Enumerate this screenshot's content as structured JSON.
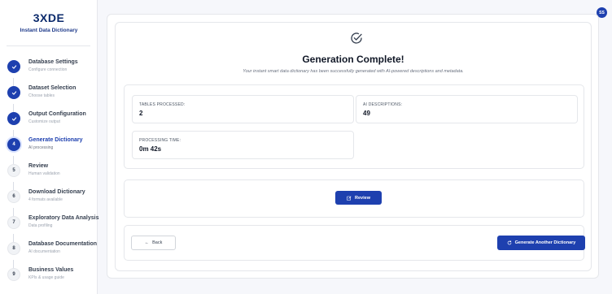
{
  "app": {
    "logo": "3XDE",
    "subtitle": "Instant Data Dictionary",
    "avatar_initials": "SS"
  },
  "steps": [
    {
      "number": "1",
      "title": "Database Settings",
      "subtitle": "Configure connection",
      "status": "completed"
    },
    {
      "number": "2",
      "title": "Dataset Selection",
      "subtitle": "Choose tables",
      "status": "completed"
    },
    {
      "number": "3",
      "title": "Output Configuration",
      "subtitle": "Customize output",
      "status": "completed"
    },
    {
      "number": "4",
      "title": "Generate Dictionary",
      "subtitle": "AI processing",
      "status": "active"
    },
    {
      "number": "5",
      "title": "Review",
      "subtitle": "Human validation",
      "status": "pending"
    },
    {
      "number": "6",
      "title": "Download Dictionary",
      "subtitle": "4 formats available",
      "status": "pending"
    },
    {
      "number": "7",
      "title": "Exploratory Data Analysis",
      "subtitle": "Data profiling",
      "status": "pending"
    },
    {
      "number": "8",
      "title": "Database Documentation",
      "subtitle": "AI documentation",
      "status": "pending"
    },
    {
      "number": "9",
      "title": "Business Values",
      "subtitle": "KPIs & usage guide",
      "status": "pending"
    }
  ],
  "main": {
    "title": "Generation Complete!",
    "subtitle": "Your instant smart data dictionary has been successfully generated with AI-powered descriptions and metadata.",
    "stats": [
      {
        "label": "TABLES PROCESSED:",
        "value": "2"
      },
      {
        "label": "AI DESCRIPTIONS:",
        "value": "49"
      },
      {
        "label": "PROCESSING TIME:",
        "value": "0m 42s"
      }
    ],
    "review_label": "Review",
    "back_label": "Back",
    "generate_label": "Generate Another Dictionary"
  },
  "colors": {
    "accent": "#1e40af",
    "logo": "#0b2a6b"
  }
}
